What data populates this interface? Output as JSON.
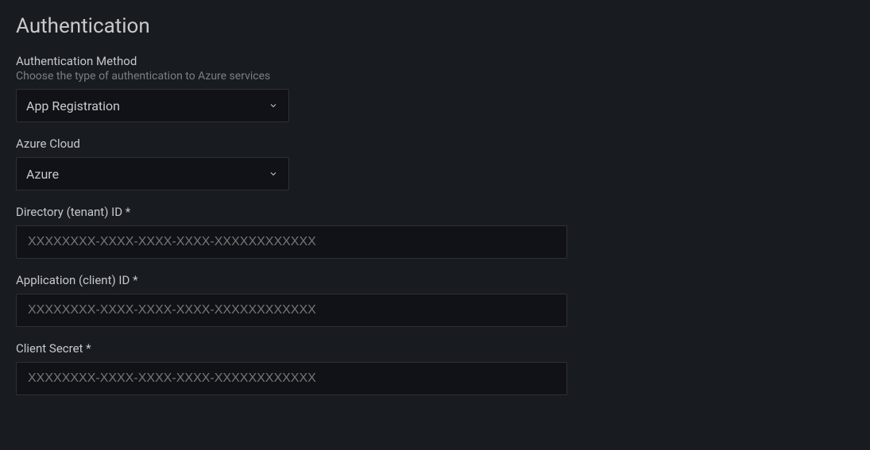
{
  "section": {
    "title": "Authentication"
  },
  "fields": {
    "auth_method": {
      "label": "Authentication Method",
      "description": "Choose the type of authentication to Azure services",
      "value": "App Registration"
    },
    "azure_cloud": {
      "label": "Azure Cloud",
      "value": "Azure"
    },
    "tenant_id": {
      "label": "Directory (tenant) ID *",
      "placeholder": "XXXXXXXX-XXXX-XXXX-XXXX-XXXXXXXXXXXX"
    },
    "client_id": {
      "label": "Application (client) ID *",
      "placeholder": "XXXXXXXX-XXXX-XXXX-XXXX-XXXXXXXXXXXX"
    },
    "client_secret": {
      "label": "Client Secret *",
      "placeholder": "XXXXXXXX-XXXX-XXXX-XXXX-XXXXXXXXXXXX"
    }
  }
}
